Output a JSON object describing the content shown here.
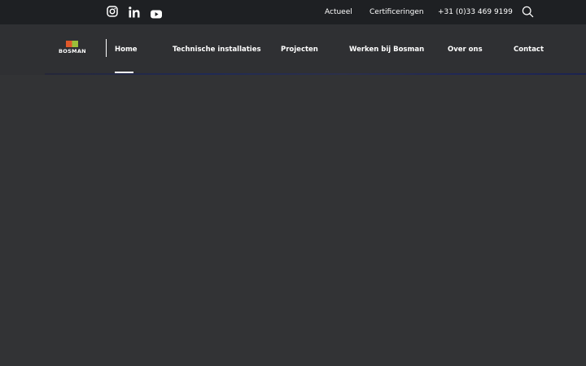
{
  "topbar": {
    "social": [
      {
        "icon": "instagram-icon"
      },
      {
        "icon": "linkedin-icon"
      },
      {
        "icon": "youtube-icon"
      }
    ],
    "links": [
      "Actueel",
      "Certificeringen",
      "+31 (0)33 469 9199"
    ],
    "search_icon": "search-icon"
  },
  "logo": {
    "text": "BOSMAN"
  },
  "nav": {
    "items": [
      "Home",
      "Technische installaties",
      "Projecten",
      "Werken bij Bosman",
      "Over ons",
      "Contact"
    ],
    "active": "Home"
  },
  "colors": {
    "topbar_bg": "#1e2023",
    "page_bg": "#323335",
    "logo_orange": "#e0582a",
    "logo_green": "#9bbf3a"
  }
}
